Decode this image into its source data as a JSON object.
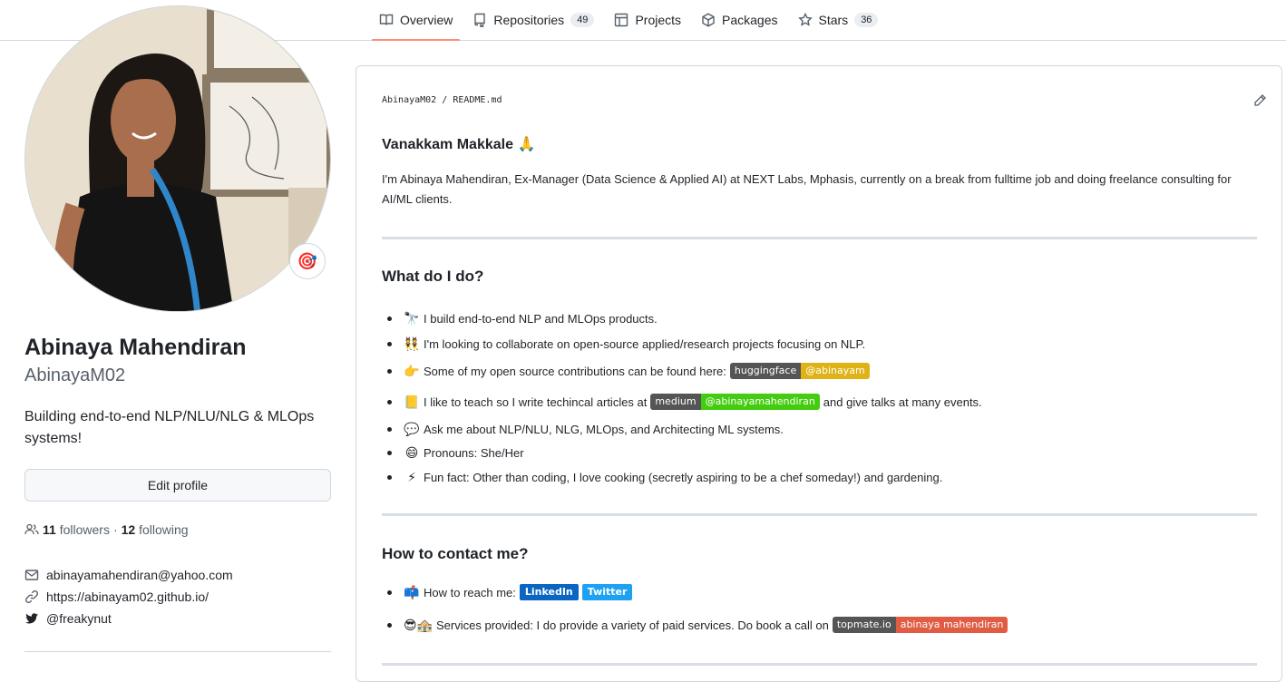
{
  "tabs": [
    {
      "label": "Overview",
      "icon": "book-icon"
    },
    {
      "label": "Repositories",
      "icon": "repo-icon",
      "count": "49"
    },
    {
      "label": "Projects",
      "icon": "table-icon"
    },
    {
      "label": "Packages",
      "icon": "package-icon"
    },
    {
      "label": "Stars",
      "icon": "star-icon",
      "count": "36"
    }
  ],
  "profile": {
    "status_emoji": "🎯",
    "name": "Abinaya Mahendiran",
    "login": "AbinayaM02",
    "bio": "Building end-to-end NLP/NLU/NLG & MLOps systems!",
    "edit_label": "Edit profile",
    "followers_count": "11",
    "followers_label": "followers",
    "dot": "·",
    "following_count": "12",
    "following_label": "following",
    "email": "abinayamahendiran@yahoo.com",
    "website": "https://abinayam02.github.io/",
    "twitter": "@freakynut"
  },
  "readme": {
    "path_user": "AbinayaM02",
    "path_sep": "/",
    "path_file": "README.md",
    "greeting": "Vanakkam Makkale",
    "greeting_emoji": "🙏",
    "intro": "I'm Abinaya Mahendiran, Ex-Manager (Data Science & Applied AI) at NEXT Labs, Mphasis, currently on a break from fulltime job and doing freelance consulting for AI/ML clients.",
    "what_heading": "What do I do?",
    "what_items": {
      "i0": {
        "emoji": "🔭",
        "text": "I build end-to-end NLP and MLOps products."
      },
      "i1": {
        "emoji": "👯",
        "text": "I'm looking to collaborate on open-source applied/research projects focusing on NLP."
      },
      "i2": {
        "emoji": "👉",
        "text": "Some of my open source contributions can be found here:",
        "badge_l": "huggingface",
        "badge_r": "@abinayam"
      },
      "i3": {
        "emoji": "📒",
        "text": "I like to teach so I write techincal articles at",
        "badge_l": "medium",
        "badge_r": "@abinayamahendiran",
        "after": "and give talks at many events."
      },
      "i4": {
        "emoji": "💬",
        "text": "Ask me about NLP/NLU, NLG, MLOps, and Architecting ML systems."
      },
      "i5": {
        "emoji": "😄",
        "text": "Pronouns: She/Her"
      },
      "i6": {
        "emoji": "⚡",
        "text": "Fun fact: Other than coding, I love cooking (secretly aspiring to be a chef someday!) and gardening."
      }
    },
    "contact_heading": "How to contact me?",
    "contact_items": {
      "c0": {
        "emoji": "📫",
        "text": "How to reach me:",
        "linkedin": "LinkedIn",
        "twitter": "Twitter"
      },
      "c1": {
        "emoji": "😎🏤",
        "text": "Services provided: I do provide a variety of paid services. Do book a call on",
        "badge_l": "topmate.io",
        "badge_r": "abinaya mahendiran"
      }
    }
  },
  "colors": {
    "accent": "#fd8c73",
    "border": "#d0d7de",
    "muted": "#57606a"
  }
}
